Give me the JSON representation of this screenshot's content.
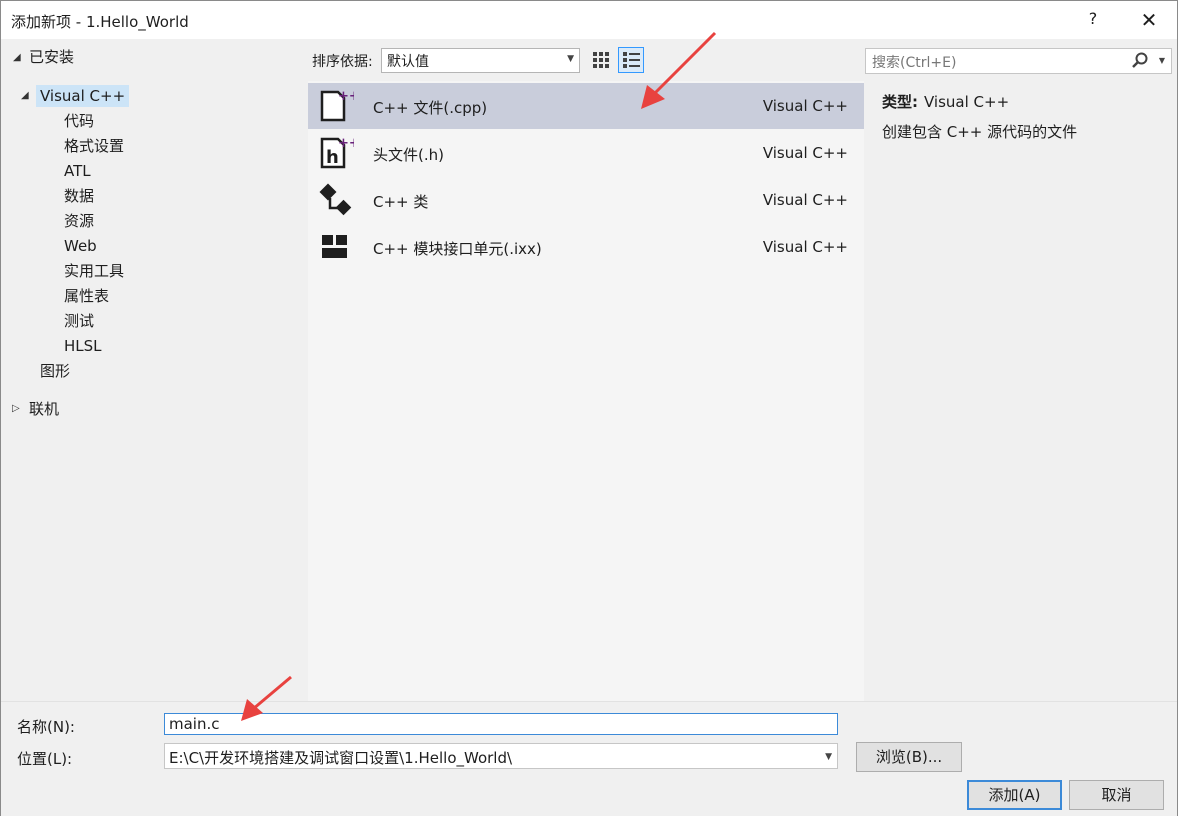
{
  "window": {
    "title": "添加新项 - 1.Hello_World",
    "help": "?",
    "close": "✕"
  },
  "tree": {
    "installed": "已安装",
    "visual_cpp": "Visual C++",
    "children": [
      "代码",
      "格式设置",
      "ATL",
      "数据",
      "资源",
      "Web",
      "实用工具",
      "属性表",
      "测试",
      "HLSL"
    ],
    "graphics": "图形",
    "online": "联机"
  },
  "toolbar": {
    "sort_label": "排序依据:",
    "sort_value": "默认值"
  },
  "search": {
    "placeholder": "搜索(Ctrl+E)"
  },
  "items": [
    {
      "name": "C++ 文件(.cpp)",
      "lang": "Visual C++",
      "icon": "cpp-file-icon"
    },
    {
      "name": "头文件(.h)",
      "lang": "Visual C++",
      "icon": "header-file-icon"
    },
    {
      "name": "C++ 类",
      "lang": "Visual C++",
      "icon": "class-icon"
    },
    {
      "name": "C++ 模块接口单元(.ixx)",
      "lang": "Visual C++",
      "icon": "module-icon"
    }
  ],
  "details": {
    "type_label": "类型:",
    "type_value": "Visual C++",
    "description": "创建包含 C++ 源代码的文件"
  },
  "form": {
    "name_label": "名称(N):",
    "name_value": "main.c",
    "location_label": "位置(L):",
    "location_value": "E:\\C\\开发环境搭建及调试窗口设置\\1.Hello_World\\",
    "browse": "浏览(B)...",
    "add": "添加(A)",
    "cancel": "取消"
  },
  "colors": {
    "selected_item": "#c9cddb",
    "tree_selected": "#cce4f7",
    "focus_border": "#3c8ad8",
    "annotation_arrow": "#e8423f",
    "icon_accent": "#68217a"
  }
}
